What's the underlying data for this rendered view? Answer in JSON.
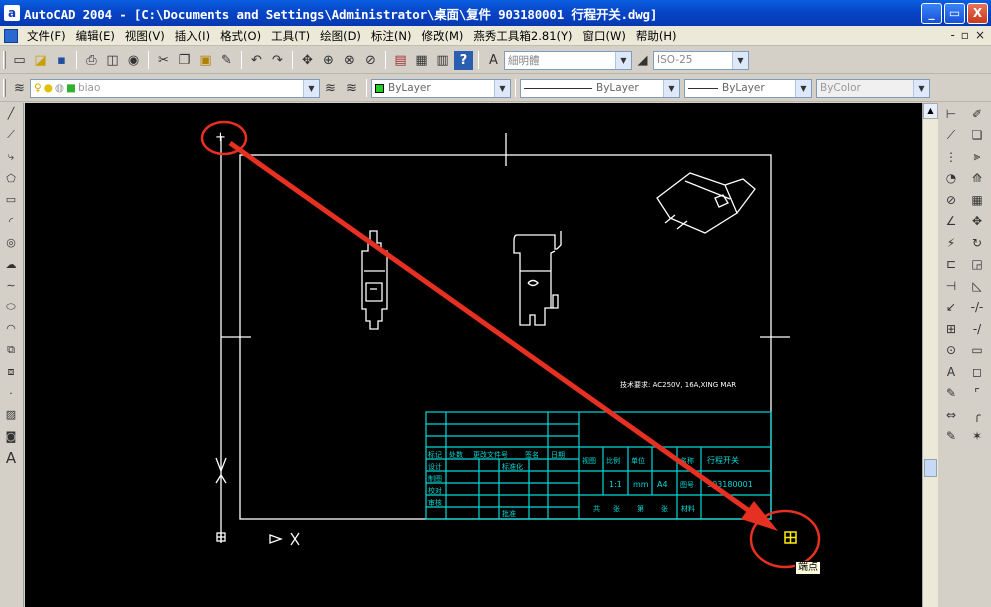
{
  "window": {
    "app_letter": "a",
    "title": "AutoCAD 2004 - [C:\\Documents and Settings\\Administrator\\桌面\\复件 903180001 行程开关.dwg]",
    "buttons": [
      "_",
      "▭",
      "X"
    ]
  },
  "menubar": {
    "items": [
      "文件(F)",
      "编辑(E)",
      "视图(V)",
      "插入(I)",
      "格式(O)",
      "工具(T)",
      "绘图(D)",
      "标注(N)",
      "修改(M)",
      "燕秀工具箱2.81(Y)",
      "窗口(W)",
      "帮助(H)"
    ],
    "doc_controls": [
      "-",
      "▫",
      "×"
    ]
  },
  "toolbar_standard": {
    "font_combo": "細明體",
    "dimstyle_combo": "ISO-25"
  },
  "toolbar_properties": {
    "layer_combo": "biao",
    "color_combo": "ByLayer",
    "linetype_combo": "ByLayer",
    "lineweight_combo": "ByLayer",
    "plotstyle_combo": "ByColor"
  },
  "drawing": {
    "tech_requirement": "技术要求: AC250V, 16A,XING MAR",
    "title_block": {
      "part_name": "行程开关",
      "part_number": "903180001",
      "scale": "1:1",
      "unit": "mm",
      "size": "A4",
      "row_labels": [
        "标记",
        "设计",
        "制图",
        "校对",
        "审核"
      ],
      "header_cells": [
        "处数",
        "更改文件号",
        "签名",
        "日期"
      ],
      "middle_labels": [
        "标准化",
        "批准"
      ],
      "right_headers": [
        "视图",
        "比例",
        "单位",
        "图号",
        "名称"
      ],
      "bottom_cells": [
        "共",
        "张",
        "第",
        "张",
        "材料"
      ]
    },
    "snap_tooltip": "端点"
  },
  "colors": {
    "canvas": "#000000",
    "border": "#ffffff",
    "title_block": "#00d8d8",
    "annotation": "#e53022",
    "snap_marker": "#ffee00"
  }
}
